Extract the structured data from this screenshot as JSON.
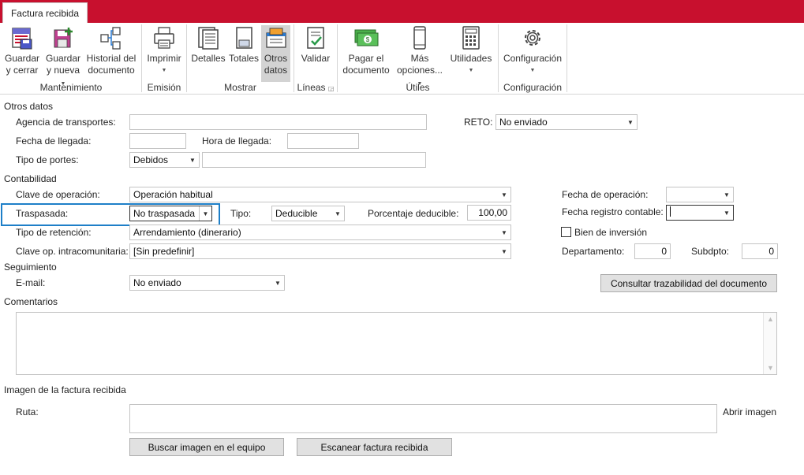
{
  "tab": {
    "title": "Factura recibida"
  },
  "ribbon": {
    "buttons": {
      "guardar_cerrar": [
        "Guardar",
        "y cerrar"
      ],
      "guardar_nueva": [
        "Guardar",
        "y nueva"
      ],
      "historial": [
        "Historial del",
        "documento"
      ],
      "imprimir": [
        "Imprimir"
      ],
      "detalles": [
        "Detalles"
      ],
      "totales": [
        "Totales"
      ],
      "otros_datos": [
        "Otros",
        "datos"
      ],
      "validar": [
        "Validar"
      ],
      "pagar": [
        "Pagar el",
        "documento"
      ],
      "mas_opciones": [
        "Más",
        "opciones..."
      ],
      "utilidades": [
        "Utilidades"
      ],
      "configuracion": [
        "Configuración"
      ]
    },
    "groups": {
      "mantenimiento": "Mantenimiento",
      "emision": "Emisión",
      "mostrar": "Mostrar",
      "lineas": "Líneas",
      "utiles": "Útiles",
      "configuracion": "Configuración"
    }
  },
  "otros_datos": {
    "section": "Otros datos",
    "agencia_label": "Agencia de transportes:",
    "agencia_value": "",
    "reto_label": "RETO:",
    "reto_value": "No enviado",
    "fecha_llegada_label": "Fecha de llegada:",
    "fecha_llegada_value": "",
    "hora_llegada_label": "Hora de llegada:",
    "hora_llegada_value": "",
    "tipo_portes_label": "Tipo de portes:",
    "tipo_portes_value": "Debidos",
    "tipo_portes_extra": ""
  },
  "contabilidad": {
    "section": "Contabilidad",
    "clave_operacion_label": "Clave de operación:",
    "clave_operacion_value": "Operación habitual",
    "fecha_operacion_label": "Fecha de operación:",
    "fecha_operacion_value": "",
    "traspasada_label": "Traspasada:",
    "traspasada_value": "No traspasada",
    "tipo_label": "Tipo:",
    "tipo_value": "Deducible",
    "porcentaje_label": "Porcentaje deducible:",
    "porcentaje_value": "100,00",
    "fecha_registro_label": "Fecha registro contable:",
    "fecha_registro_value": "",
    "tipo_retencion_label": "Tipo de retención:",
    "tipo_retencion_value": "Arrendamiento (dinerario)",
    "bien_inversion_label": "Bien de inversión",
    "clave_intra_label": "Clave op. intracomunitaria:",
    "clave_intra_value": "[Sin predefinir]",
    "departamento_label": "Departamento:",
    "departamento_value": "0",
    "subdpto_label": "Subdpto:",
    "subdpto_value": "0"
  },
  "seguimiento": {
    "section": "Seguimiento",
    "email_label": "E-mail:",
    "email_value": "No enviado",
    "consultar_button": "Consultar trazabilidad del documento"
  },
  "comentarios": {
    "section": "Comentarios",
    "value": ""
  },
  "imagen": {
    "section": "Imagen de la factura recibida",
    "ruta_label": "Ruta:",
    "ruta_value": "",
    "abrir_link": "Abrir imagen",
    "buscar_button": "Buscar imagen en el equipo",
    "escanear_button": "Escanear factura recibida"
  }
}
